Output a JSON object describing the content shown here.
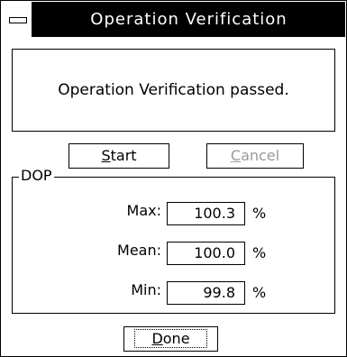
{
  "window": {
    "title": "Operation Verification"
  },
  "message": "Operation Verification passed.",
  "buttons": {
    "start": {
      "ul": "S",
      "rest": "tart"
    },
    "cancel": {
      "ul": "C",
      "rest": "ancel"
    },
    "done": {
      "ul": "D",
      "rest": "one"
    }
  },
  "dop": {
    "label": "DOP",
    "rows": [
      {
        "label": "Max:",
        "value": "100.3",
        "unit": "%"
      },
      {
        "label": "Mean:",
        "value": "100.0",
        "unit": "%"
      },
      {
        "label": "Min:",
        "value": "99.8",
        "unit": "%"
      }
    ]
  }
}
